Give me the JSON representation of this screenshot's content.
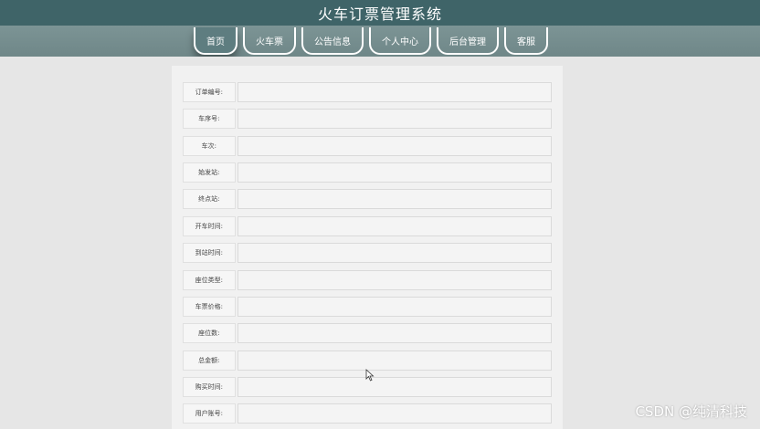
{
  "app": {
    "title": "火车订票管理系统"
  },
  "nav": {
    "items": [
      {
        "label": "首页"
      },
      {
        "label": "火车票"
      },
      {
        "label": "公告信息"
      },
      {
        "label": "个人中心"
      },
      {
        "label": "后台管理"
      },
      {
        "label": "客服"
      }
    ]
  },
  "form": {
    "fields": [
      {
        "label": "订单编号:",
        "value": ""
      },
      {
        "label": "车序号:",
        "value": ""
      },
      {
        "label": "车次:",
        "value": ""
      },
      {
        "label": "始发站:",
        "value": ""
      },
      {
        "label": "终点站:",
        "value": ""
      },
      {
        "label": "开车时间:",
        "value": ""
      },
      {
        "label": "到站时间:",
        "value": ""
      },
      {
        "label": "座位类型:",
        "value": ""
      },
      {
        "label": "车票价格:",
        "value": ""
      },
      {
        "label": "座位数:",
        "value": ""
      },
      {
        "label": "总金额:",
        "value": ""
      },
      {
        "label": "购买时间:",
        "value": ""
      },
      {
        "label": "用户账号:",
        "value": ""
      }
    ]
  },
  "watermark": {
    "text": "CSDN @纯清科技"
  }
}
